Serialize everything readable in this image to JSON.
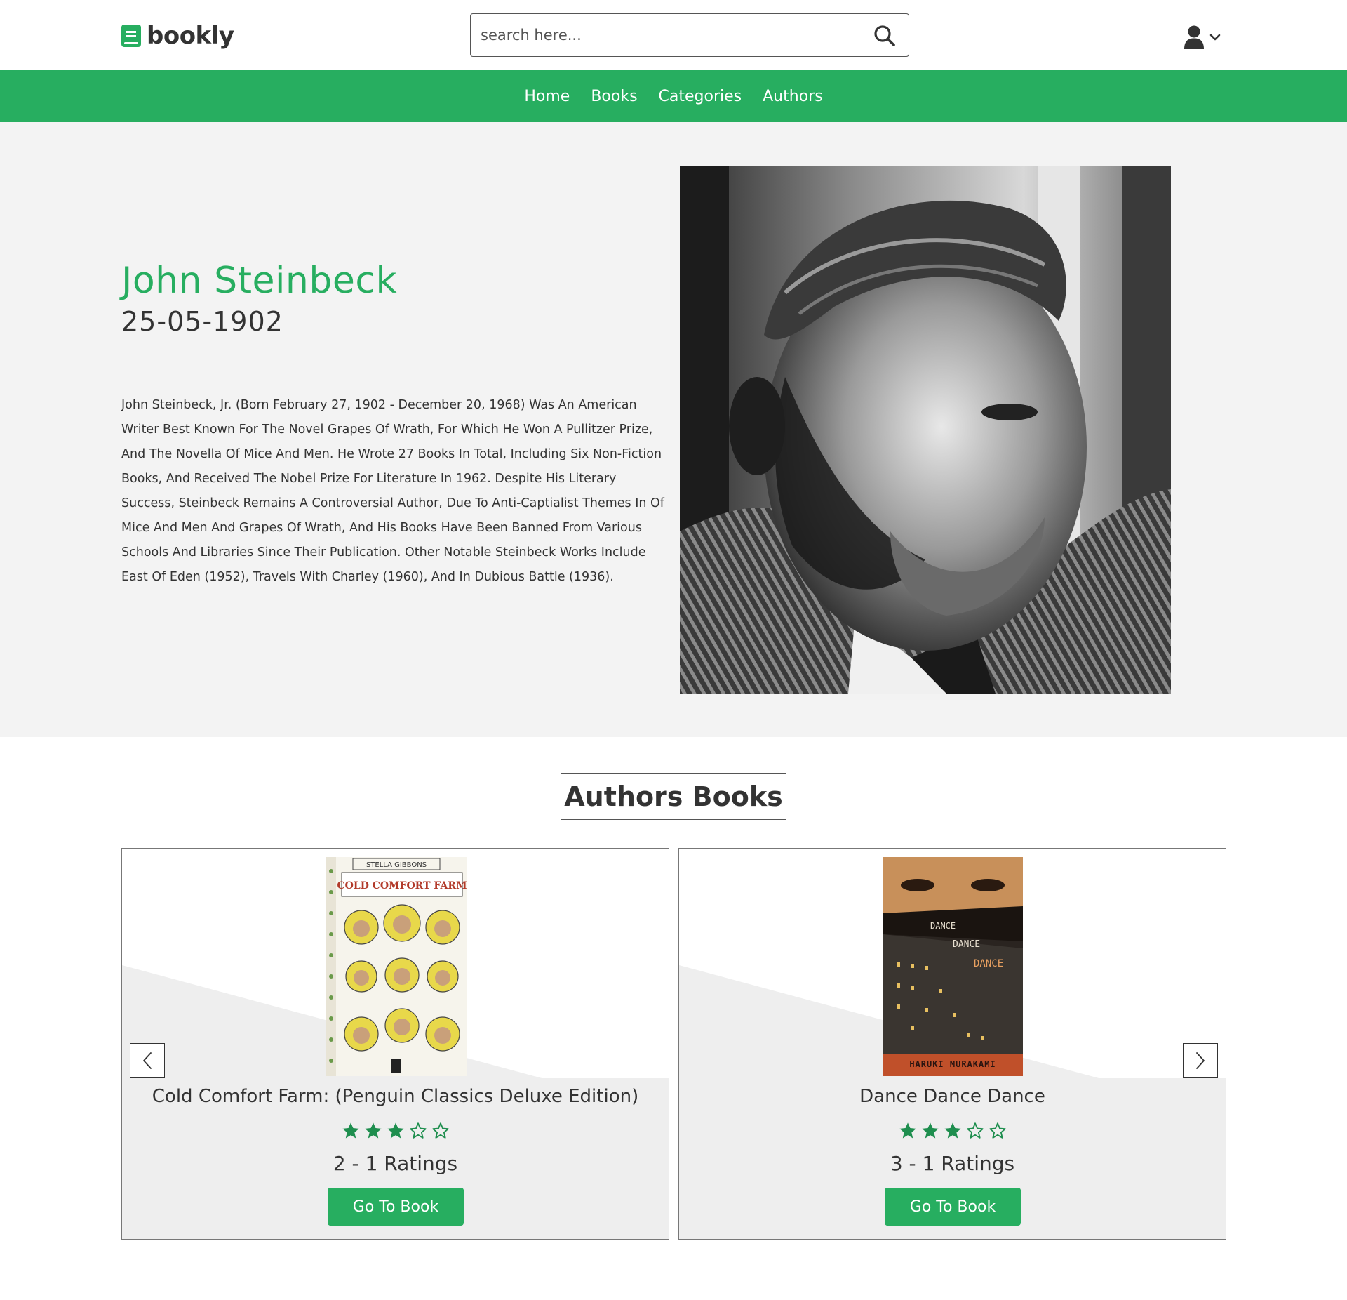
{
  "header": {
    "logo_text": "bookly",
    "search_placeholder": "search here..."
  },
  "nav": {
    "items": [
      "Home",
      "Books",
      "Categories",
      "Authors"
    ]
  },
  "author": {
    "name": "John Steinbeck",
    "date": "25-05-1902",
    "bio": "John Steinbeck, Jr. (Born February 27, 1902 - December 20, 1968) Was An American Writer Best Known For The Novel Grapes Of Wrath, For Which He Won A Pullitzer Prize, And The Novella Of Mice And Men. He Wrote 27 Books In Total, Including Six Non-Fiction Books, And Received The Nobel Prize For Literature In 1962. Despite His Literary Success, Steinbeck Remains A Controversial Author, Due To Anti-Captialist Themes In Of Mice And Men And Grapes Of Wrath, And His Books Have Been Banned From Various Schools And Libraries Since Their Publication. Other Notable Steinbeck Works Include East Of Eden (1952), Travels With Charley (1960), And In Dubious Battle (1936)."
  },
  "books_section": {
    "title": "Authors Books",
    "books": [
      {
        "title": "Cold Comfort Farm: (Penguin Classics Deluxe Edition)",
        "stars_filled": 3,
        "stars_total": 5,
        "ratings": "2 - 1 Ratings",
        "button": "Go To Book",
        "cover_author": "STELLA GIBBONS",
        "cover_title": "COLD COMFORT FARM"
      },
      {
        "title": "Dance Dance Dance",
        "stars_filled": 3,
        "stars_total": 5,
        "ratings": "3 - 1 Ratings",
        "button": "Go To Book",
        "cover_words": [
          "DANCE",
          "DANCE",
          "DANCE"
        ],
        "cover_author": "HARUKI MURAKAMI"
      }
    ]
  },
  "colors": {
    "brand_green": "#27ae60",
    "star_green": "#1e8e4e"
  }
}
